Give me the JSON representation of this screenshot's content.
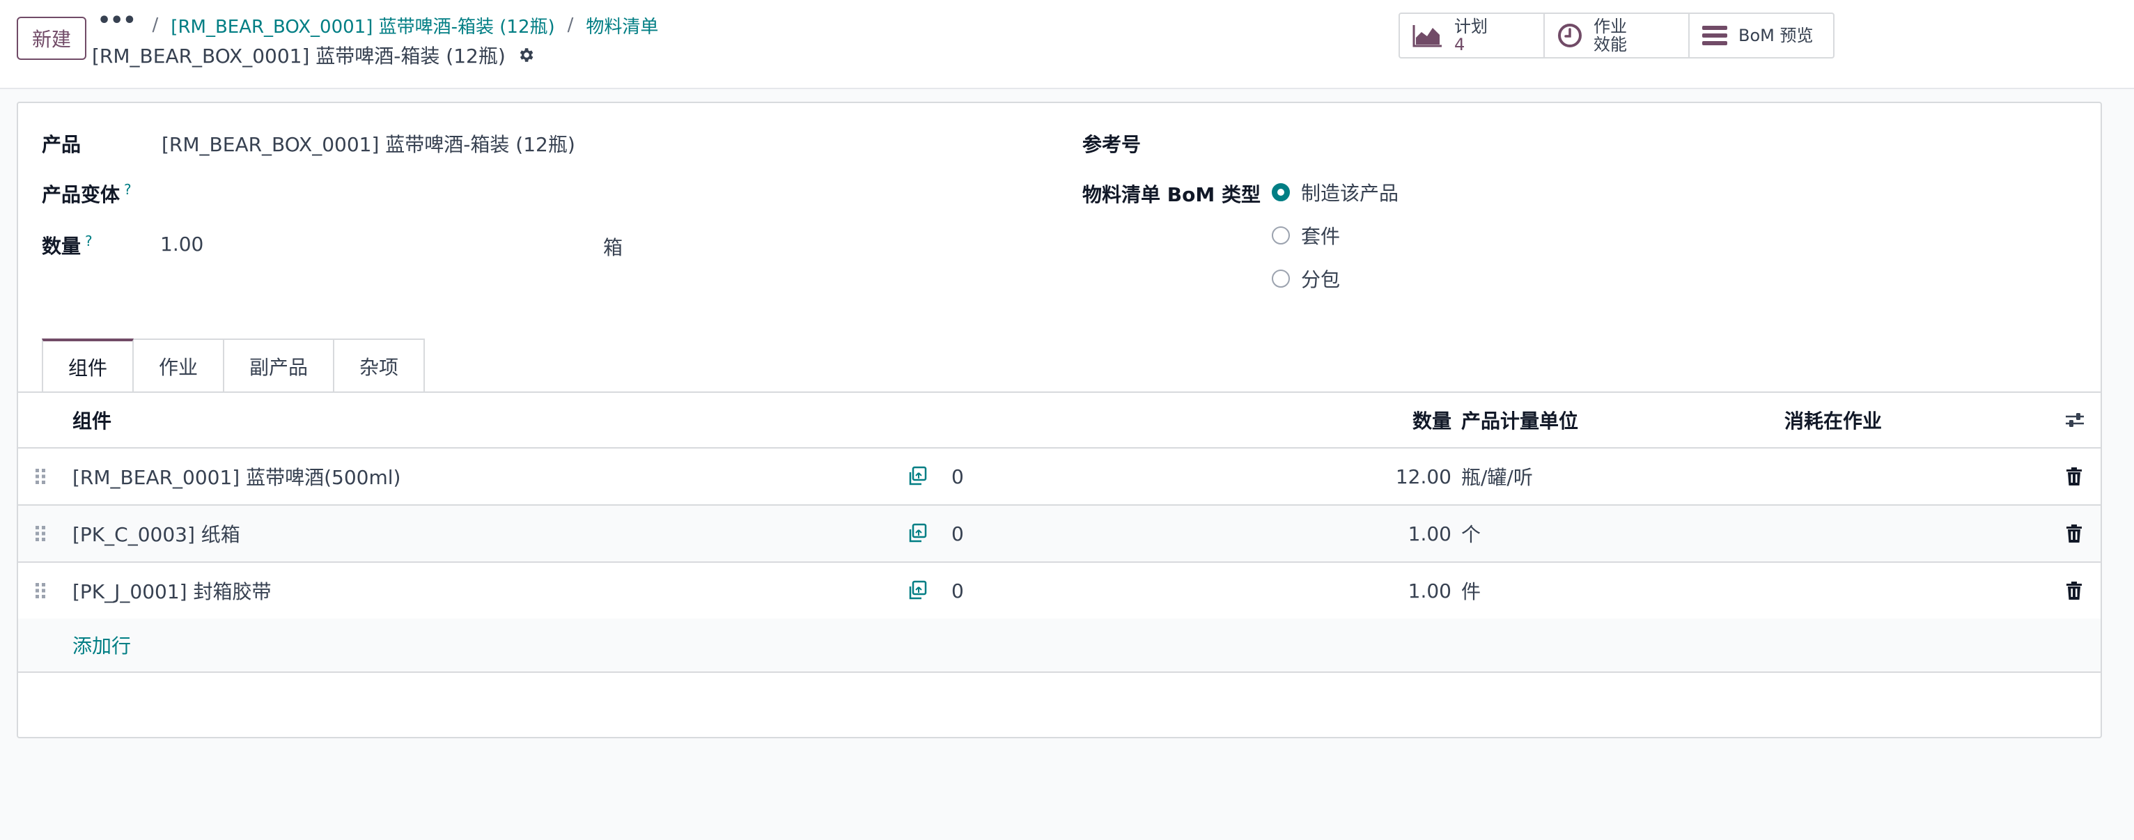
{
  "control_panel": {
    "new_button": "新建",
    "breadcrumb": {
      "more": "•••",
      "separator": "/",
      "parent_link": "[RM_BEAR_BOX_0001] 蓝带啤酒-箱装 (12瓶)",
      "current_link": "物料清单"
    },
    "record_title": "[RM_BEAR_BOX_0001] 蓝带啤酒-箱装 (12瓶)",
    "smart_buttons": [
      {
        "label": "计划",
        "value": "4",
        "icon": "area-chart-icon"
      },
      {
        "label_line1": "作业",
        "label_line2": "效能",
        "icon": "clock-icon"
      },
      {
        "label": "BoM 预览",
        "icon": "bars-icon"
      }
    ]
  },
  "form": {
    "product": {
      "label": "产品",
      "value": "[RM_BEAR_BOX_0001] 蓝带啤酒-箱装 (12瓶)"
    },
    "variant": {
      "label": "产品变体",
      "help": "?"
    },
    "quantity": {
      "label": "数量",
      "help": "?",
      "value": "1.00",
      "uom": "箱"
    },
    "reference": {
      "label": "参考号"
    },
    "bom_type": {
      "label": "物料清单 BoM 类型",
      "options": [
        "制造该产品",
        "套件",
        "分包"
      ],
      "selected": "制造该产品"
    }
  },
  "tabs": [
    "组件",
    "作业",
    "副产品",
    "杂项"
  ],
  "active_tab": "组件",
  "table": {
    "headers": {
      "component": "组件",
      "quantity": "数量",
      "uom": "产品计量单位",
      "consumed_in": "消耗在作业"
    },
    "rows": [
      {
        "component": "[RM_BEAR_0001] 蓝带啤酒(500ml)",
        "copies": "0",
        "quantity": "12.00",
        "uom": "瓶/罐/听"
      },
      {
        "component": "[PK_C_0003] 纸箱",
        "copies": "0",
        "quantity": "1.00",
        "uom": "个"
      },
      {
        "component": "[PK_J_0001] 封箱胶带",
        "copies": "0",
        "quantity": "1.00",
        "uom": "件"
      }
    ],
    "add_line": "添加行"
  },
  "colors": {
    "brand": "#714b67",
    "link": "#017e84",
    "border": "#d8dadd",
    "background": "#f9fafb"
  }
}
